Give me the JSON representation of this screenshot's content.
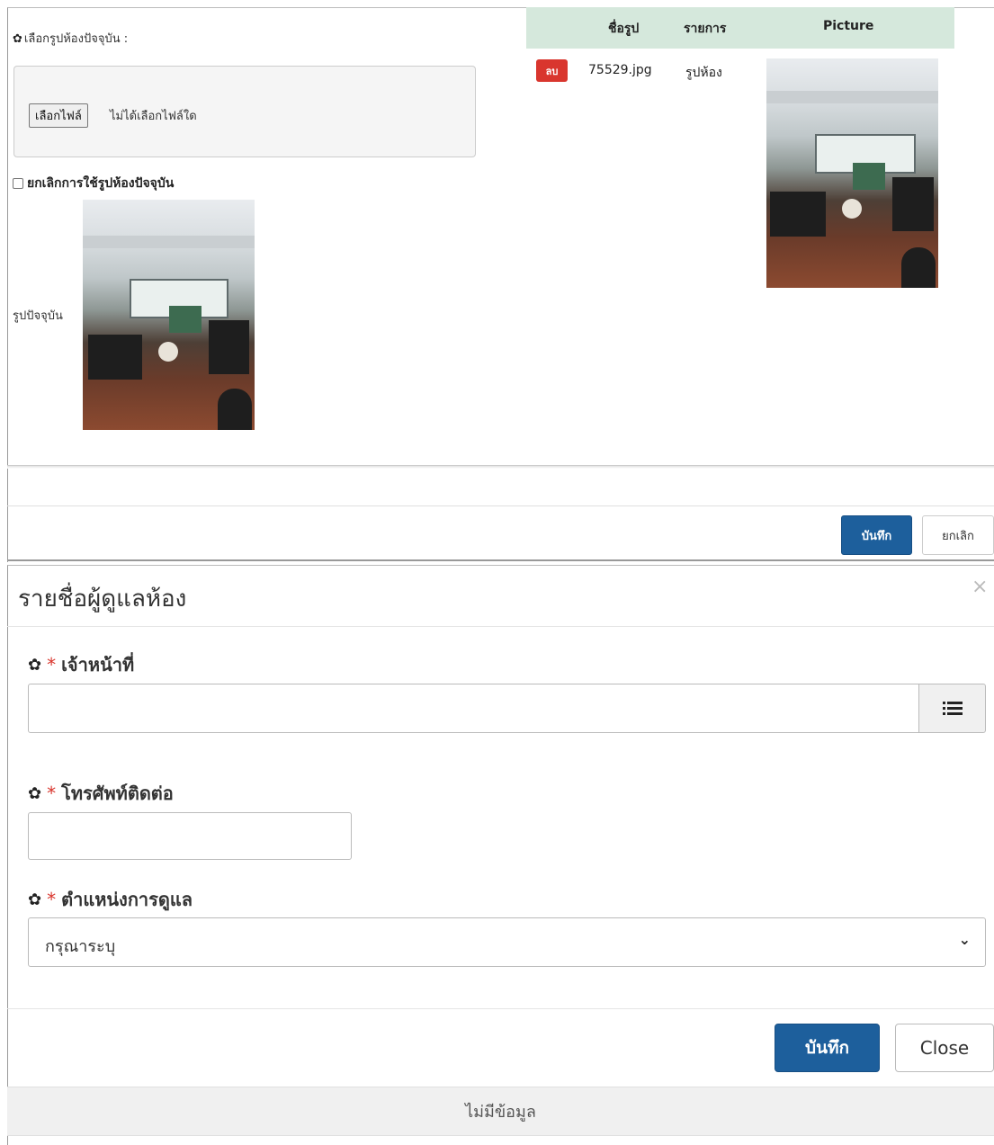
{
  "top_panel": {
    "select_label": "เลือกรูปห้องปัจจุบัน :",
    "file_button": "เลือกไฟล์",
    "file_status": "ไม่ได้เลือกไฟล์ใด",
    "cancel_checkbox_label": "ยกเลิกการใช้รูปห้องปัจจุบัน",
    "current_label": "รูปปัจจุบัน",
    "table": {
      "headers": [
        "ชื่อรูป",
        "รายการ",
        "Picture"
      ],
      "rows": [
        {
          "delete_label": "ลบ",
          "name": "75529.jpg",
          "item": "รูปห้อง"
        }
      ]
    },
    "save_label": "บันทึก",
    "cancel_label": "ยกเลิก"
  },
  "modal": {
    "title": "รายชื่อผู้ดูแลห้อง",
    "close_symbol": "×",
    "fields": {
      "officer_label": "เจ้าหน้าที่",
      "phone_label": "โทรศัพท์ติดต่อ",
      "position_label": "ตำแหน่งการดูแล",
      "position_selected": "กรุณาระบุ",
      "required_mark": "*"
    },
    "save_label": "บันทึก",
    "close_label": "Close",
    "no_data": "ไม่มีข้อมูล"
  },
  "colors": {
    "primary": "#1d5f9c",
    "danger": "#d9362e",
    "table_header": "#d5e8dc"
  },
  "icons": {
    "gear": "gear-icon",
    "list": "list-icon",
    "chevron": "chevron-down-icon",
    "close": "close-icon"
  }
}
